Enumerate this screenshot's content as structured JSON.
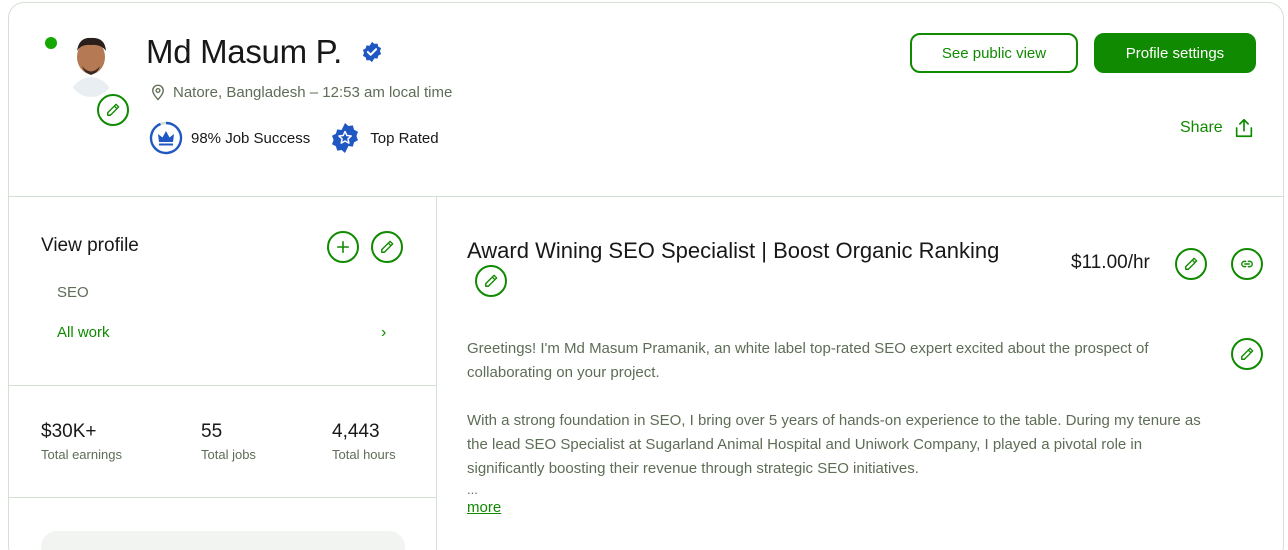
{
  "profile": {
    "name": "Md Masum P.",
    "location": "Natore, Bangladesh – 12:53 am local time",
    "job_success": "98% Job Success",
    "top_rated": "Top Rated",
    "online_color": "#14a800"
  },
  "header": {
    "public_view_label": "See public view",
    "settings_label": "Profile settings",
    "share_label": "Share"
  },
  "sidebar": {
    "view_profile_label": "View profile",
    "tag": "SEO",
    "all_work_label": "All work",
    "chevron": "›"
  },
  "stats": [
    {
      "value": "$30K+",
      "label": "Total earnings"
    },
    {
      "value": "55",
      "label": "Total jobs"
    },
    {
      "value": "4,443",
      "label": "Total hours"
    }
  ],
  "main": {
    "title": "Award Wining SEO Specialist | Boost Organic Ranking",
    "rate": "$11.00/hr",
    "description": [
      "Greetings! I'm Md Masum Pramanik, an white label top-rated SEO expert excited about the prospect of collaborating on your project.",
      "With a strong foundation in SEO, I bring over 5 years of hands-on experience to the table. During my tenure as the lead SEO Specialist at Sugarland Animal Hospital and Uniwork Company, I played a pivotal role in significantly boosting their revenue through strategic SEO initiatives."
    ],
    "ellipsis": "...",
    "more_label": "more"
  },
  "colors": {
    "brand_green": "#108a00",
    "muted_text": "#5e6d55",
    "badge_blue": "#1f57c3",
    "border": "#d5e0d5"
  },
  "icons": [
    "pencil-icon",
    "plus-icon",
    "link-icon",
    "share-icon",
    "location-pin-icon",
    "verified-badge-icon",
    "crown-icon",
    "star-badge-icon"
  ]
}
